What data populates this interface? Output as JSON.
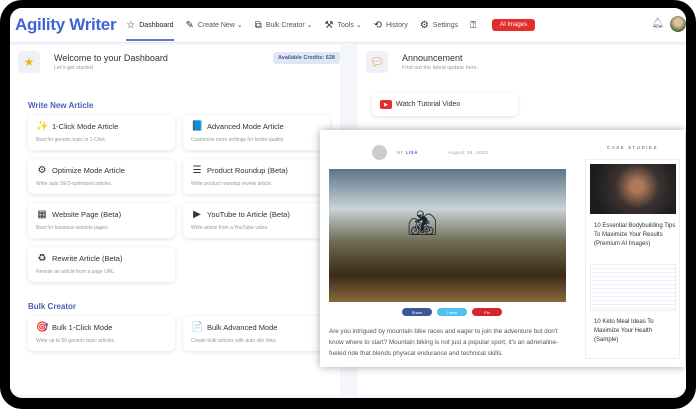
{
  "nav": {
    "logo": "Agility Writer",
    "items": [
      {
        "label": "Dashboard",
        "icon": "star-icon"
      },
      {
        "label": "Create New ⌄",
        "icon": "pencil-icon"
      },
      {
        "label": "Bulk Creator ⌄",
        "icon": "bulk-icon"
      },
      {
        "label": "Tools ⌄",
        "icon": "tools-icon"
      },
      {
        "label": "History",
        "icon": "history-icon"
      },
      {
        "label": "Settings",
        "icon": "gear-icon"
      }
    ],
    "ai_images": "AI Images"
  },
  "welcome": {
    "title": "Welcome to your Dashboard",
    "subtitle": "Let's get started",
    "credits": "Available Credits: 628"
  },
  "write_new": {
    "heading": "Write New Article",
    "cards": [
      {
        "title": "1-Click Mode Article",
        "desc": "Best for generic topic in 1-Click.",
        "icon": "✨"
      },
      {
        "title": "Advanced Mode Article",
        "desc": "Customize more settings for better quality.",
        "icon": "📘"
      },
      {
        "title": "Optimize Mode Article",
        "desc": "Write auto SEO-optimized articles.",
        "icon": "⚙"
      },
      {
        "title": "Product Roundup (Beta)",
        "desc": "Write product roundup review article.",
        "icon": "☰"
      },
      {
        "title": "Website Page (Beta)",
        "desc": "Best for business website pages.",
        "icon": "▦"
      },
      {
        "title": "YouTube to Article (Beta)",
        "desc": "Write article from a YouTube video.",
        "icon": "▶"
      },
      {
        "title": "Rewrite Article (Beta)",
        "desc": "Rewrite an article from a page URL.",
        "icon": "♻"
      }
    ]
  },
  "bulk": {
    "heading": "Bulk Creator",
    "cards": [
      {
        "title": "Bulk 1-Click Mode",
        "desc": "Write up to 50 generic topic articles.",
        "icon": "🎯"
      },
      {
        "title": "Bulk Advanced Mode",
        "desc": "Create bulk articles with auto silo links.",
        "icon": "📄"
      }
    ]
  },
  "announcement": {
    "title": "Announcement",
    "subtitle": "Find out the latest update here.",
    "tutorial": "Watch Tutorial Video"
  },
  "article": {
    "by": "BY",
    "author": "LISA",
    "date": "August 26, 2023",
    "share": [
      "Share",
      "Tweet",
      "Pin"
    ],
    "body": "Are you intrigued by mountain bike races and eager to join the adventure but don't know where to start? Mountain biking is not just a popular sport; it's an adrenaline-fueled ride that blends physical endurance and technical skills.",
    "case_studies": "CASE STUDIES",
    "posts": [
      "10 Essential Bodybuilding Tips To Maximize Your Results (Premium AI Images)",
      "10 Keto Meal Ideas To Maximize Your Health (Sample)"
    ]
  }
}
